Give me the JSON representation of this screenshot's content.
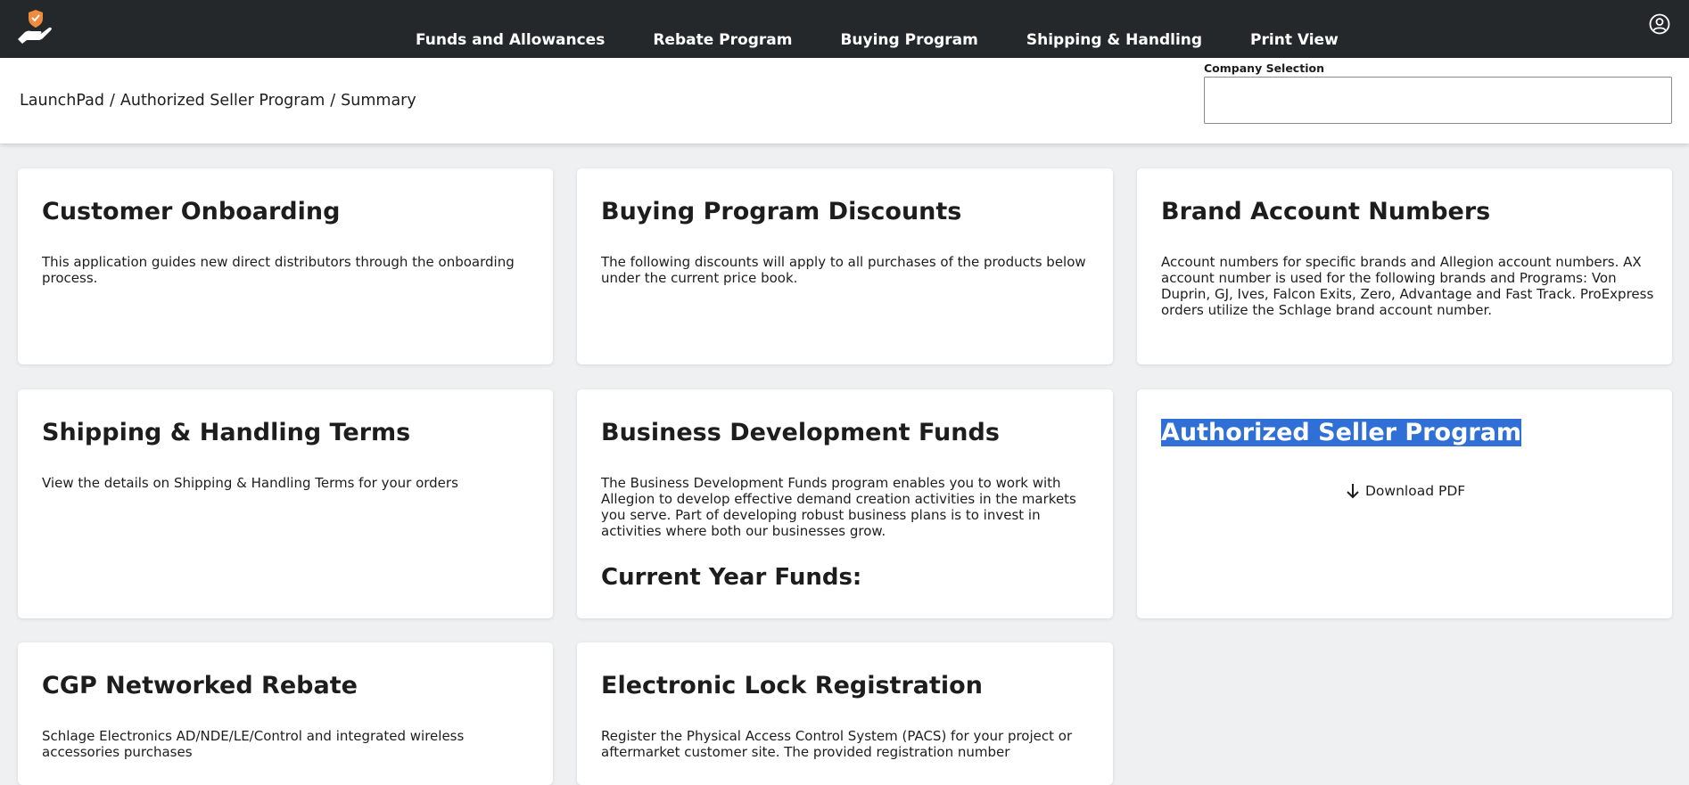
{
  "nav": {
    "items": [
      {
        "label": "Funds and Allowances"
      },
      {
        "label": "Rebate Program"
      },
      {
        "label": "Buying Program"
      },
      {
        "label": "Shipping & Handling"
      },
      {
        "label": "Print View"
      }
    ],
    "logo_icon": "hand-shield-logo-icon",
    "user_icon": "user-circle-icon"
  },
  "breadcrumb": {
    "items": [
      "LaunchPad",
      "Authorized Seller Program",
      "Summary"
    ],
    "separator": "/"
  },
  "company_selection": {
    "label": "Company Selection",
    "value": ""
  },
  "cards": {
    "customer_onboarding": {
      "title": "Customer Onboarding",
      "description": "This application guides new direct distributors through the onboarding process."
    },
    "buying_program_discounts": {
      "title": "Buying Program Discounts",
      "description": "The following discounts will apply to all purchases of the products below under the current price book."
    },
    "brand_account_numbers": {
      "title": "Brand Account Numbers",
      "description": "Account numbers for specific brands and Allegion account numbers. AX account number is used for the following brands and Programs: Von Duprin, GJ, Ives, Falcon Exits, Zero, Advantage and Fast Track. ProExpress orders utilize the Schlage brand account number."
    },
    "shipping_handling_terms": {
      "title": "Shipping & Handling Terms",
      "description": "View the details on Shipping & Handling Terms for your orders"
    },
    "business_development_funds": {
      "title": "Business Development Funds",
      "description": "The Business Development Funds program enables you to work with Allegion to develop effective demand creation activities in the markets you serve. Part of developing robust business plans is to invest in activities where both our businesses grow.",
      "subtitle": "Current Year Funds:"
    },
    "authorized_seller_program": {
      "title": "Authorized Seller Program",
      "download_label": "Download PDF",
      "download_icon": "arrow-down-icon"
    },
    "cgp_networked_rebate": {
      "title": "CGP Networked Rebate",
      "description": "Schlage Electronics AD/NDE/LE/Control and integrated wireless accessories purchases"
    },
    "electronic_lock_registration": {
      "title": "Electronic Lock Registration",
      "description": "Register the Physical Access Control System (PACS) for your project or aftermarket customer site. The provided registration number"
    }
  },
  "colors": {
    "topbar": "#25282b",
    "background": "#eff0f2",
    "selection_highlight": "#2f6fd6"
  }
}
